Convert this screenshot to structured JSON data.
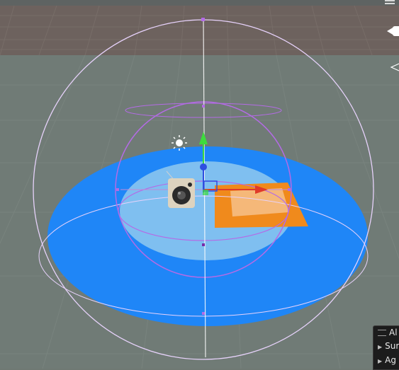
{
  "scene_view": {
    "colors": {
      "sky": "#6b6f6e",
      "grid_far": "#6e6460",
      "ground": "#707b76",
      "disc_outer": "#1f86f7",
      "disc_inner": "#7fbff0",
      "plane_orange": "#f08a1c",
      "plane_light": "#f6c08a",
      "gizmo_sphere": "#d9b8f7",
      "gizmo_purple": "#b46be6",
      "axis_y": "#3ddc3d",
      "axis_x": "#e03a2a",
      "axis_z": "#2f4fe0"
    },
    "icons": [
      "sun-icon",
      "audio-source-icon",
      "camera-icon",
      "menu-icon"
    ]
  },
  "overlay_panel": {
    "header": "Al",
    "items": [
      {
        "label": "Sur",
        "icon": "expand-arrow-icon"
      },
      {
        "label": "Ag",
        "icon": "expand-arrow-icon"
      }
    ]
  }
}
